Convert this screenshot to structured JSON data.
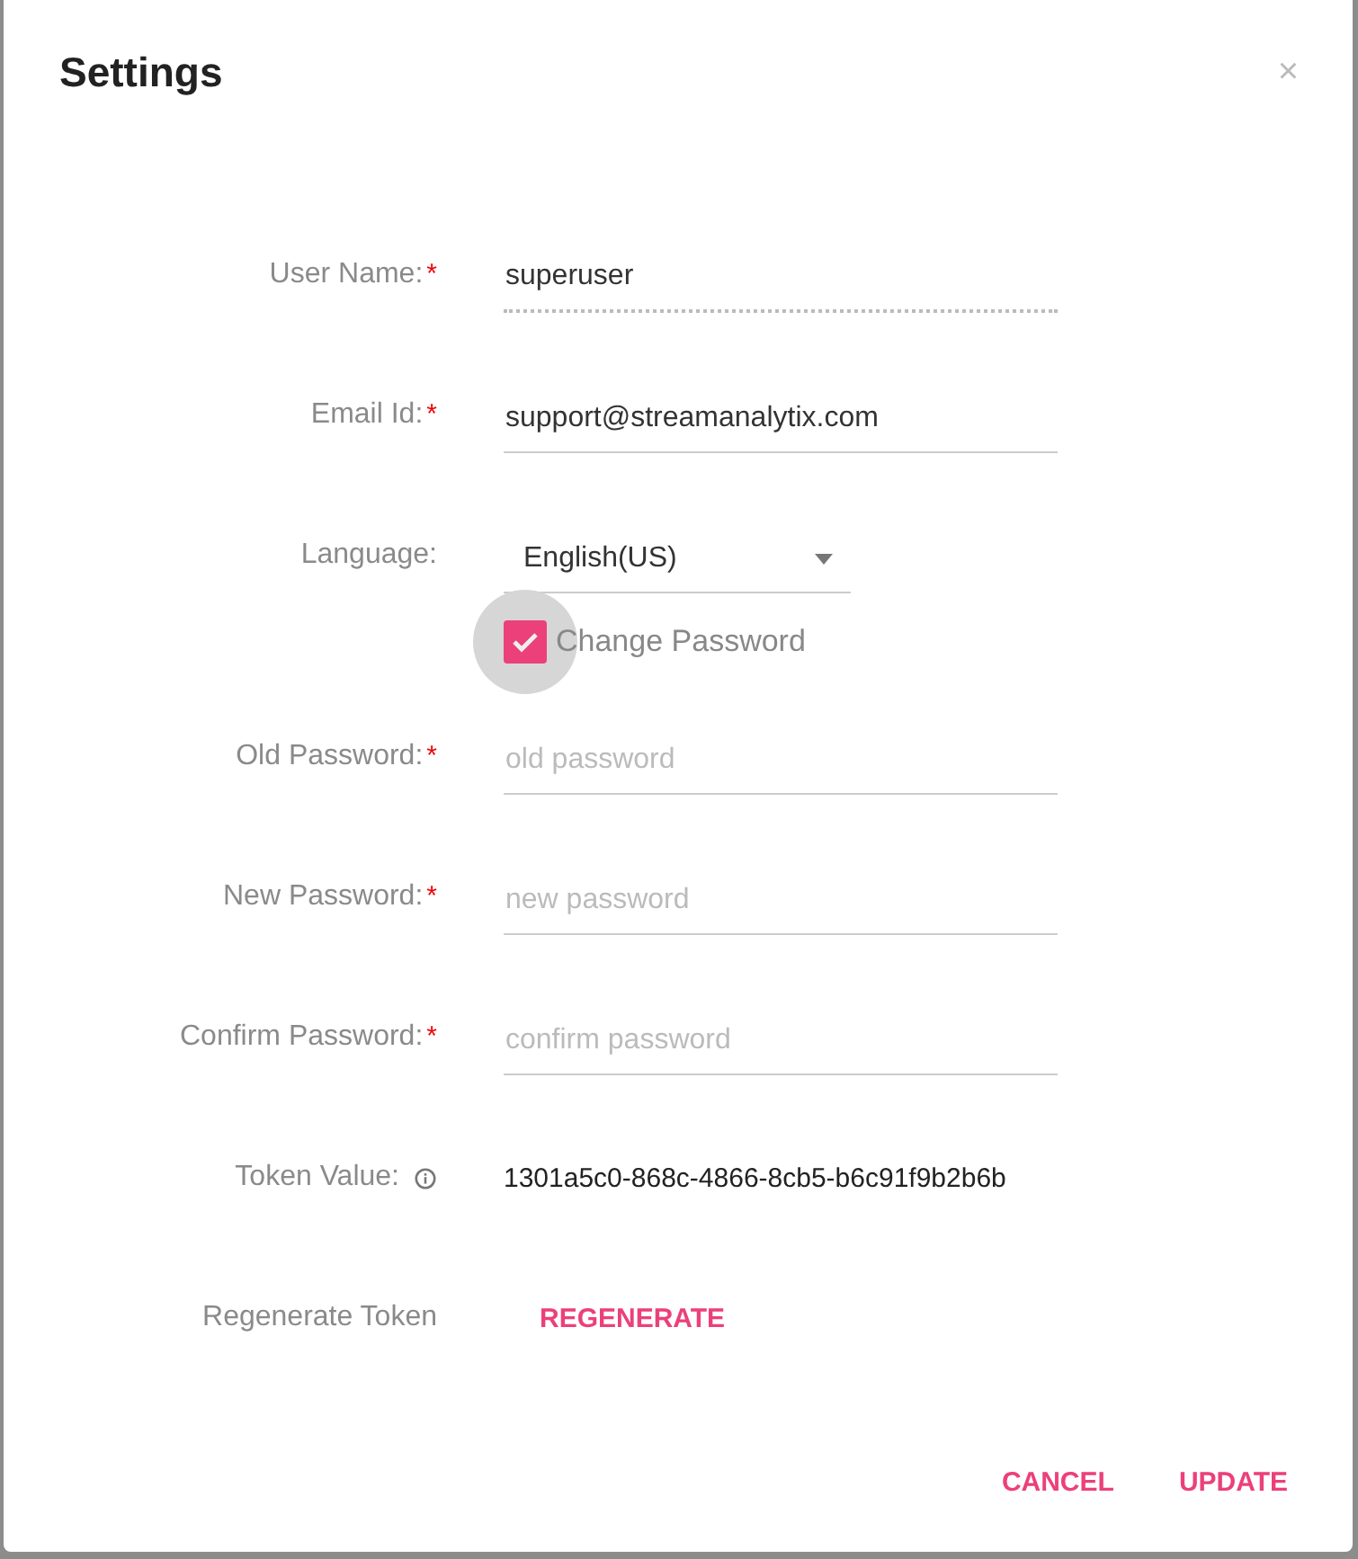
{
  "dialog": {
    "title": "Settings",
    "close": "×"
  },
  "fields": [
    {
      "kind": "text",
      "label": "User Name:",
      "required": true,
      "value": "superuser",
      "disabled": true
    },
    {
      "kind": "text",
      "label": "Email Id:",
      "required": true,
      "value": "support@streamanalytix.com",
      "disabled": false
    },
    {
      "kind": "select",
      "label": "Language:",
      "required": false,
      "value": "English(US)"
    },
    {
      "kind": "checkbox",
      "label": "Change Password",
      "checked": true
    },
    {
      "kind": "text",
      "label": "Old Password:",
      "required": true,
      "placeholder": "old password",
      "disabled": false
    },
    {
      "kind": "text",
      "label": "New Password:",
      "required": true,
      "placeholder": "new password",
      "disabled": false
    },
    {
      "kind": "text",
      "label": "Confirm Password:",
      "required": true,
      "placeholder": "confirm password",
      "disabled": false
    },
    {
      "kind": "token",
      "label": "Token Value:",
      "value": "1301a5c0-868c-4866-8cb5-b6c91f9b2b6b"
    },
    {
      "kind": "action",
      "label": "Regenerate Token",
      "button": "REGENERATE"
    }
  ],
  "required_mark": "*",
  "buttons": [
    "CANCEL",
    "UPDATE"
  ]
}
